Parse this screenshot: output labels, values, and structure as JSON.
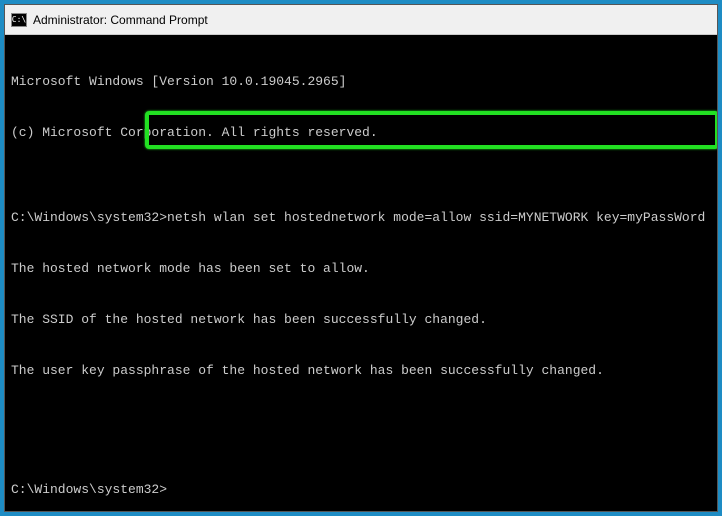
{
  "titlebar": {
    "icon_label": "C:\\",
    "title": "Administrator: Command Prompt"
  },
  "terminal": {
    "line1": "Microsoft Windows [Version 10.0.19045.2965]",
    "line2": "(c) Microsoft Corporation. All rights reserved.",
    "blank1": "",
    "prompt1_prefix": "C:\\Windows\\system32>",
    "prompt1_command": "netsh wlan set hostednetwork mode=allow ssid=MYNETWORK key=myPassWord",
    "result1": "The hosted network mode has been set to allow.",
    "result2": "The SSID of the hosted network has been successfully changed.",
    "result3": "The user key passphrase of the hosted network has been successfully changed.",
    "blank2": "",
    "blank3": "",
    "prompt2": "C:\\Windows\\system32>"
  }
}
